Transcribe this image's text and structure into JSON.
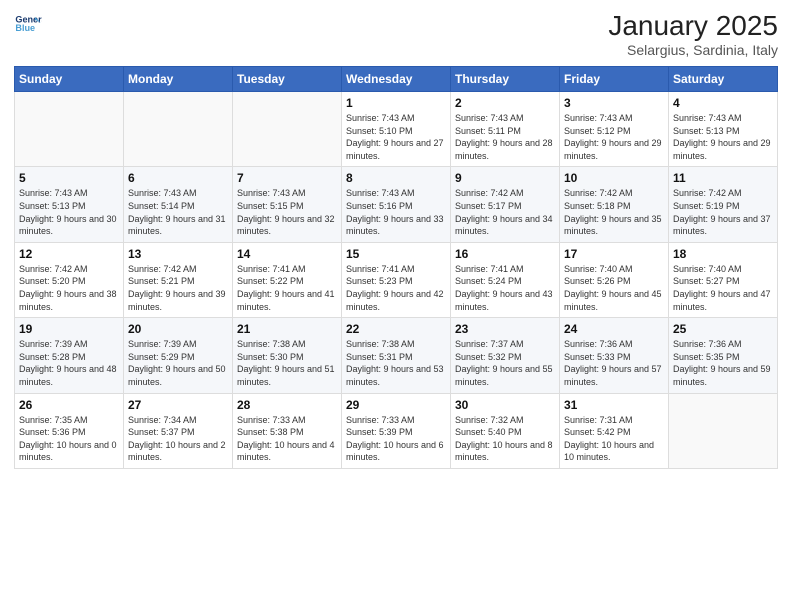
{
  "header": {
    "logo_line1": "General",
    "logo_line2": "Blue",
    "title": "January 2025",
    "subtitle": "Selargius, Sardinia, Italy"
  },
  "weekdays": [
    "Sunday",
    "Monday",
    "Tuesday",
    "Wednesday",
    "Thursday",
    "Friday",
    "Saturday"
  ],
  "weeks": [
    [
      {
        "day": "",
        "info": ""
      },
      {
        "day": "",
        "info": ""
      },
      {
        "day": "",
        "info": ""
      },
      {
        "day": "1",
        "info": "Sunrise: 7:43 AM\nSunset: 5:10 PM\nDaylight: 9 hours and 27 minutes."
      },
      {
        "day": "2",
        "info": "Sunrise: 7:43 AM\nSunset: 5:11 PM\nDaylight: 9 hours and 28 minutes."
      },
      {
        "day": "3",
        "info": "Sunrise: 7:43 AM\nSunset: 5:12 PM\nDaylight: 9 hours and 29 minutes."
      },
      {
        "day": "4",
        "info": "Sunrise: 7:43 AM\nSunset: 5:13 PM\nDaylight: 9 hours and 29 minutes."
      }
    ],
    [
      {
        "day": "5",
        "info": "Sunrise: 7:43 AM\nSunset: 5:13 PM\nDaylight: 9 hours and 30 minutes."
      },
      {
        "day": "6",
        "info": "Sunrise: 7:43 AM\nSunset: 5:14 PM\nDaylight: 9 hours and 31 minutes."
      },
      {
        "day": "7",
        "info": "Sunrise: 7:43 AM\nSunset: 5:15 PM\nDaylight: 9 hours and 32 minutes."
      },
      {
        "day": "8",
        "info": "Sunrise: 7:43 AM\nSunset: 5:16 PM\nDaylight: 9 hours and 33 minutes."
      },
      {
        "day": "9",
        "info": "Sunrise: 7:42 AM\nSunset: 5:17 PM\nDaylight: 9 hours and 34 minutes."
      },
      {
        "day": "10",
        "info": "Sunrise: 7:42 AM\nSunset: 5:18 PM\nDaylight: 9 hours and 35 minutes."
      },
      {
        "day": "11",
        "info": "Sunrise: 7:42 AM\nSunset: 5:19 PM\nDaylight: 9 hours and 37 minutes."
      }
    ],
    [
      {
        "day": "12",
        "info": "Sunrise: 7:42 AM\nSunset: 5:20 PM\nDaylight: 9 hours and 38 minutes."
      },
      {
        "day": "13",
        "info": "Sunrise: 7:42 AM\nSunset: 5:21 PM\nDaylight: 9 hours and 39 minutes."
      },
      {
        "day": "14",
        "info": "Sunrise: 7:41 AM\nSunset: 5:22 PM\nDaylight: 9 hours and 41 minutes."
      },
      {
        "day": "15",
        "info": "Sunrise: 7:41 AM\nSunset: 5:23 PM\nDaylight: 9 hours and 42 minutes."
      },
      {
        "day": "16",
        "info": "Sunrise: 7:41 AM\nSunset: 5:24 PM\nDaylight: 9 hours and 43 minutes."
      },
      {
        "day": "17",
        "info": "Sunrise: 7:40 AM\nSunset: 5:26 PM\nDaylight: 9 hours and 45 minutes."
      },
      {
        "day": "18",
        "info": "Sunrise: 7:40 AM\nSunset: 5:27 PM\nDaylight: 9 hours and 47 minutes."
      }
    ],
    [
      {
        "day": "19",
        "info": "Sunrise: 7:39 AM\nSunset: 5:28 PM\nDaylight: 9 hours and 48 minutes."
      },
      {
        "day": "20",
        "info": "Sunrise: 7:39 AM\nSunset: 5:29 PM\nDaylight: 9 hours and 50 minutes."
      },
      {
        "day": "21",
        "info": "Sunrise: 7:38 AM\nSunset: 5:30 PM\nDaylight: 9 hours and 51 minutes."
      },
      {
        "day": "22",
        "info": "Sunrise: 7:38 AM\nSunset: 5:31 PM\nDaylight: 9 hours and 53 minutes."
      },
      {
        "day": "23",
        "info": "Sunrise: 7:37 AM\nSunset: 5:32 PM\nDaylight: 9 hours and 55 minutes."
      },
      {
        "day": "24",
        "info": "Sunrise: 7:36 AM\nSunset: 5:33 PM\nDaylight: 9 hours and 57 minutes."
      },
      {
        "day": "25",
        "info": "Sunrise: 7:36 AM\nSunset: 5:35 PM\nDaylight: 9 hours and 59 minutes."
      }
    ],
    [
      {
        "day": "26",
        "info": "Sunrise: 7:35 AM\nSunset: 5:36 PM\nDaylight: 10 hours and 0 minutes."
      },
      {
        "day": "27",
        "info": "Sunrise: 7:34 AM\nSunset: 5:37 PM\nDaylight: 10 hours and 2 minutes."
      },
      {
        "day": "28",
        "info": "Sunrise: 7:33 AM\nSunset: 5:38 PM\nDaylight: 10 hours and 4 minutes."
      },
      {
        "day": "29",
        "info": "Sunrise: 7:33 AM\nSunset: 5:39 PM\nDaylight: 10 hours and 6 minutes."
      },
      {
        "day": "30",
        "info": "Sunrise: 7:32 AM\nSunset: 5:40 PM\nDaylight: 10 hours and 8 minutes."
      },
      {
        "day": "31",
        "info": "Sunrise: 7:31 AM\nSunset: 5:42 PM\nDaylight: 10 hours and 10 minutes."
      },
      {
        "day": "",
        "info": ""
      }
    ]
  ]
}
